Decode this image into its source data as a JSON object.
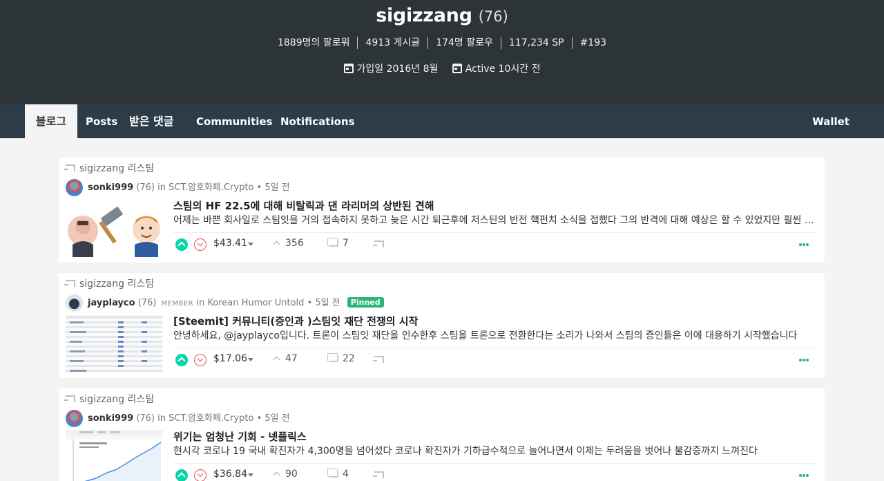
{
  "profile": {
    "name": "sigizzang",
    "reputation": "(76)",
    "stats": [
      "1889명의 팔로워",
      "4913 게시글",
      "174명 팔로우",
      "117,234 SP",
      "#193"
    ],
    "joined": "가입일 2016년 8월",
    "active": "Active 10시간 전"
  },
  "nav": {
    "tabs": [
      "블로그",
      "Posts",
      "받은 댓글",
      "Communities",
      "Notifications"
    ],
    "wallet": "Wallet"
  },
  "posts": [
    {
      "reblog_label": "sigizzang 리스팀",
      "author": "sonki999",
      "author_rep": "(76)",
      "member_tag": "",
      "community": "in SCT.암호화폐.Crypto",
      "time": "• 5일 전",
      "pinned": "",
      "title": "스팀의 HF 22.5에 대해 비탈릭과 댄 라리머의 상반된 견해",
      "summary": "어제는 바쁜 회사일로 스팀잇을 거의 접속하지 못하고 늦은 시간 퇴근후에 저스틴의 반전 핵펀치 소식을 접했다 그의 반격에 대해 예상은 할 수 있었지만 훨씬 강력한 한방이었다",
      "payout": "$43.41",
      "votes": "356",
      "comments": "7"
    },
    {
      "reblog_label": "sigizzang 리스팀",
      "author": "jayplayco",
      "author_rep": "(76)",
      "member_tag": "MEMBER",
      "community": "in Korean Humor Untold",
      "time": "• 5일 전",
      "pinned": "Pinned",
      "title": "[Steemit] 커뮤니티(증인과 )스팀잇 재단 전쟁의 시작",
      "summary": "안녕하세요, @jayplayco입니다. 트론이 스팀잇 재단을 인수한후 스팀을 트론으로 전환한다는 소리가 나와서 스팀의 증인들은 이에 대응하기 시작했습니다",
      "payout": "$17.06",
      "votes": "47",
      "comments": "22"
    },
    {
      "reblog_label": "sigizzang 리스팀",
      "author": "sonki999",
      "author_rep": "(76)",
      "member_tag": "",
      "community": "in SCT.암호화폐.Crypto",
      "time": "• 5일 전",
      "pinned": "",
      "title": "위기는 엄청난 기회 - 넷플릭스",
      "summary": "현시각 코로나 19 국내 확진자가 4,300명을 넘어섰다 코로나 확진자가 기하급수적으로 늘어나면서 이제는 두려움을 벗어나 불감증까지 느껴진다",
      "payout": "$36.84",
      "votes": "90",
      "comments": "4"
    }
  ]
}
